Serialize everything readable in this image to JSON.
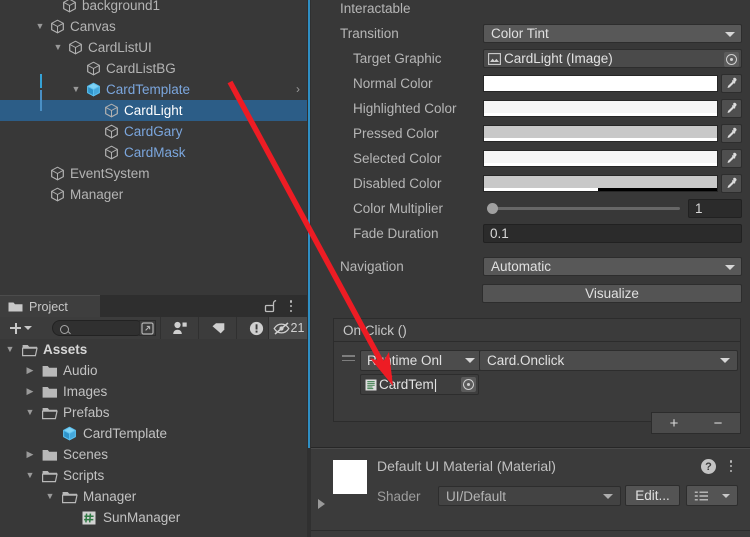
{
  "hierarchy": {
    "rows": [
      {
        "label": "background1",
        "indent": 62,
        "icon": "cube-icon",
        "twisty": "",
        "selected": false,
        "style": "normal",
        "chevron": false
      },
      {
        "label": "Canvas",
        "indent": 50,
        "icon": "cube-icon",
        "twisty": "▼",
        "selected": false,
        "style": "normal",
        "chevron": false
      },
      {
        "label": "CardListUI",
        "indent": 68,
        "icon": "cube-icon",
        "twisty": "▼",
        "selected": false,
        "style": "normal",
        "chevron": false
      },
      {
        "label": "CardListBG",
        "indent": 86,
        "icon": "cube-icon",
        "twisty": "",
        "selected": false,
        "style": "normal",
        "chevron": false
      },
      {
        "label": "CardTemplate",
        "indent": 86,
        "icon": "prefab-cube-icon",
        "twisty": "▼",
        "selected": false,
        "style": "prefab",
        "chevron": true
      },
      {
        "label": "CardLight",
        "indent": 104,
        "icon": "cube-icon",
        "twisty": "",
        "selected": true,
        "style": "normal",
        "chevron": false
      },
      {
        "label": "CardGary",
        "indent": 104,
        "icon": "cube-icon",
        "twisty": "",
        "selected": false,
        "style": "prefab",
        "chevron": false
      },
      {
        "label": "CardMask",
        "indent": 104,
        "icon": "cube-icon",
        "twisty": "",
        "selected": false,
        "style": "prefab",
        "chevron": false
      },
      {
        "label": "EventSystem",
        "indent": 50,
        "icon": "cube-icon",
        "twisty": "",
        "selected": false,
        "style": "normal",
        "chevron": false
      },
      {
        "label": "Manager",
        "indent": 50,
        "icon": "cube-icon",
        "twisty": "",
        "selected": false,
        "style": "normal",
        "chevron": false
      }
    ]
  },
  "project": {
    "tab_label": "Project",
    "search_value": "",
    "hidden_count": "21",
    "tree": [
      {
        "label": "Assets",
        "indent": 22,
        "icon": "folder-open-icon",
        "twisty": "▼",
        "bold": true
      },
      {
        "label": "Audio",
        "indent": 42,
        "icon": "folder-closed-icon",
        "twisty": "▶",
        "bold": false
      },
      {
        "label": "Images",
        "indent": 42,
        "icon": "folder-closed-icon",
        "twisty": "▶",
        "bold": false
      },
      {
        "label": "Prefabs",
        "indent": 42,
        "icon": "folder-open-icon",
        "twisty": "▼",
        "bold": false
      },
      {
        "label": "CardTemplate",
        "indent": 62,
        "icon": "prefab-cube-icon",
        "twisty": "",
        "bold": false
      },
      {
        "label": "Scenes",
        "indent": 42,
        "icon": "folder-closed-icon",
        "twisty": "▶",
        "bold": false
      },
      {
        "label": "Scripts",
        "indent": 42,
        "icon": "folder-open-icon",
        "twisty": "▼",
        "bold": false
      },
      {
        "label": "Manager",
        "indent": 62,
        "icon": "folder-open-icon",
        "twisty": "▼",
        "bold": false
      },
      {
        "label": "SunManager",
        "indent": 82,
        "icon": "cs-script-icon",
        "twisty": "",
        "bold": false
      }
    ]
  },
  "inspector": {
    "interactable_label": "Interactable",
    "interactable_checked": true,
    "transition_label": "Transition",
    "transition_value": "Color Tint",
    "target_graphic_label": "Target Graphic",
    "target_graphic_value": "CardLight (Image)",
    "colors": [
      {
        "label": "Normal Color",
        "hex": "#ffffff",
        "alpha_pct": 100
      },
      {
        "label": "Highlighted Color",
        "hex": "#f5f5f5",
        "alpha_pct": 100
      },
      {
        "label": "Pressed Color",
        "hex": "#c8c8c8",
        "alpha_pct": 100
      },
      {
        "label": "Selected Color",
        "hex": "#f5f5f5",
        "alpha_pct": 100
      },
      {
        "label": "Disabled Color",
        "hex": "#c8c8c8",
        "alpha_pct": 49
      }
    ],
    "color_multiplier_label": "Color Multiplier",
    "color_multiplier_value": "1",
    "fade_duration_label": "Fade Duration",
    "fade_duration_value": "0.1",
    "navigation_label": "Navigation",
    "navigation_value": "Automatic",
    "visualize_label": "Visualize",
    "onclick_header": "On Click ()",
    "onclick_mode": "Runtime Onl",
    "onclick_function": "Card.Onclick",
    "onclick_object": "CardTem|",
    "add_label": "+",
    "remove_label": "−"
  },
  "material": {
    "title": "Default UI Material (Material)",
    "shader_label": "Shader",
    "shader_value": "UI/Default",
    "edit_label": "Edit...",
    "swatch_hex": "#ffffff"
  },
  "accent": {
    "selection_blue": "#2c5d87",
    "prefab_blue": "#7ba6dd",
    "guide_blue": "#2f8fc4",
    "arrow_red": "#ed1c24"
  }
}
